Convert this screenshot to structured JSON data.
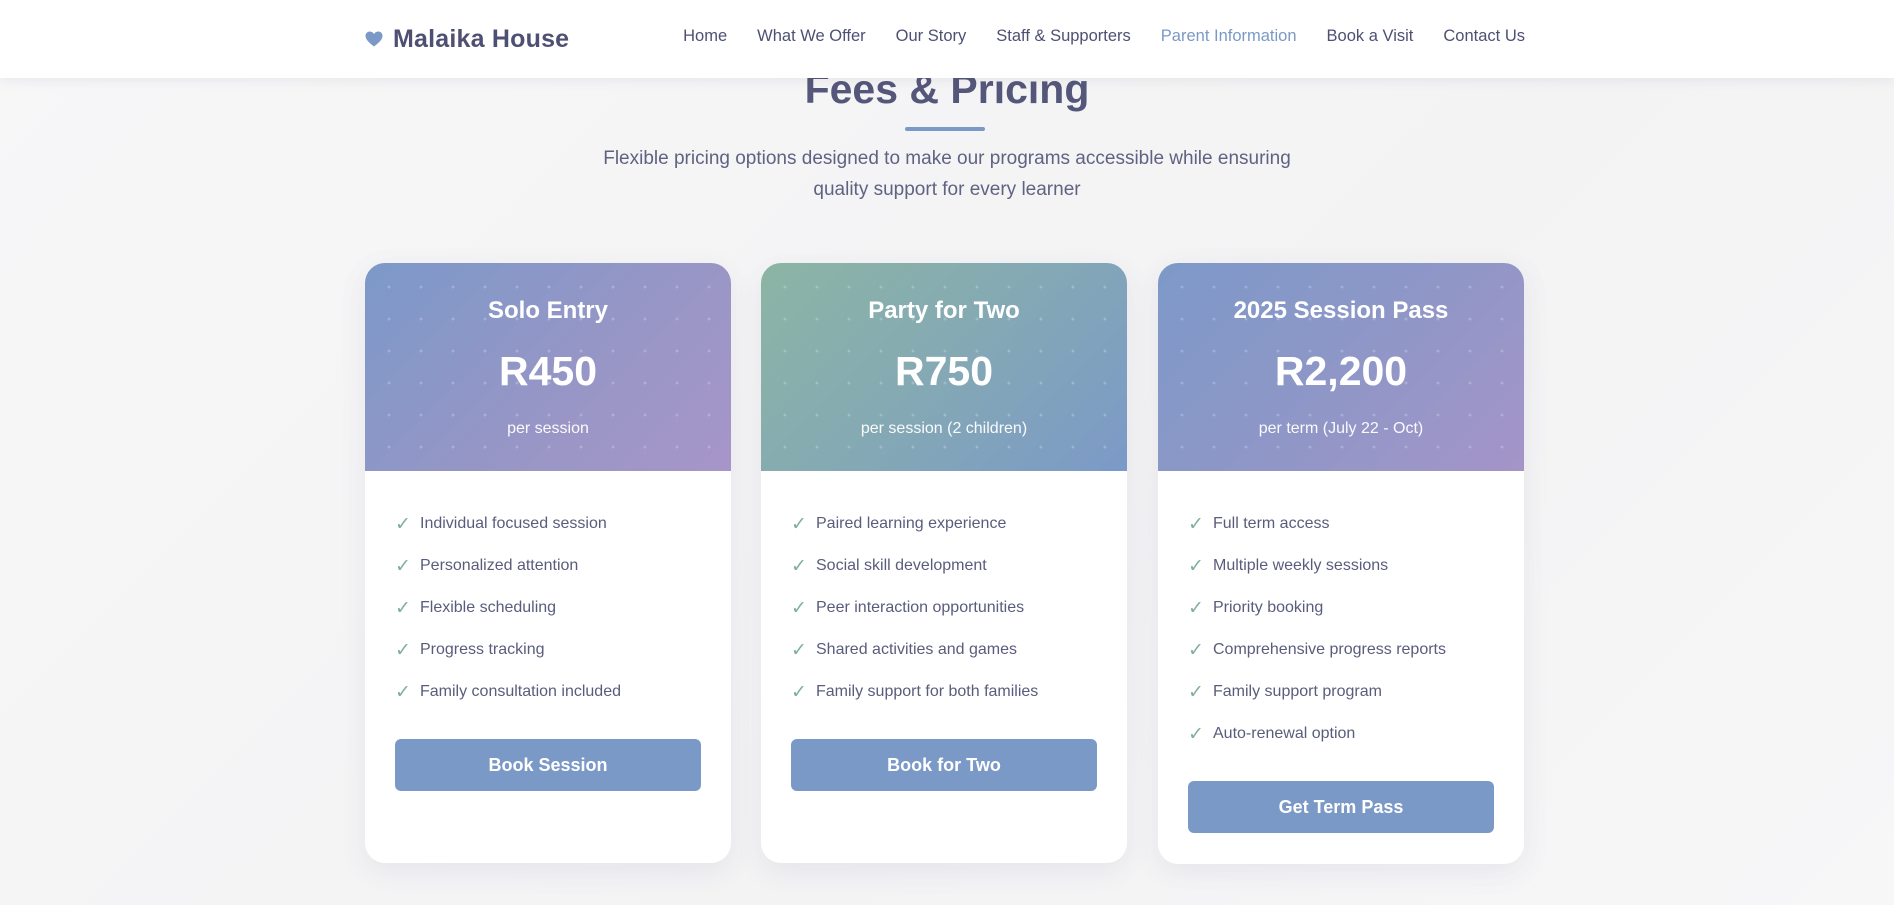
{
  "brand": {
    "name": "Malaika House",
    "icon": "heart-icon",
    "icon_color": "#7b99c6"
  },
  "nav": {
    "items": [
      {
        "label": "Home",
        "active": false
      },
      {
        "label": "What We Offer",
        "active": false
      },
      {
        "label": "Our Story",
        "active": false
      },
      {
        "label": "Staff & Supporters",
        "active": false
      },
      {
        "label": "Parent Information",
        "active": true
      },
      {
        "label": "Book a Visit",
        "active": false
      },
      {
        "label": "Contact Us",
        "active": false
      }
    ]
  },
  "section": {
    "title": "Fees & Pricing",
    "subtitle_line1": "Flexible pricing options designed to make our programs accessible while ensuring",
    "subtitle_line2": "quality support for every learner"
  },
  "plans": [
    {
      "name": "Solo Entry",
      "price": "R450",
      "period": "per session",
      "features": [
        "Individual focused session",
        "Personalized attention",
        "Flexible scheduling",
        "Progress tracking",
        "Family consultation included"
      ],
      "cta": "Book Session"
    },
    {
      "name": "Party for Two",
      "price": "R750",
      "period": "per session (2 children)",
      "features": [
        "Paired learning experience",
        "Social skill development",
        "Peer interaction opportunities",
        "Shared activities and games",
        "Family support for both families"
      ],
      "cta": "Book for Two"
    },
    {
      "name": "2025 Session Pass",
      "price": "R2,200",
      "period": "per term (July 22 - Oct)",
      "features": [
        "Full term access",
        "Multiple weekly sessions",
        "Priority booking",
        "Comprehensive progress reports",
        "Family support program",
        "Auto-renewal option"
      ],
      "cta": "Get Term Pass"
    }
  ],
  "check_glyph": "✓",
  "colors": {
    "accent": "#7b99c6",
    "heading": "#55577a",
    "check": "#7fb09c"
  }
}
